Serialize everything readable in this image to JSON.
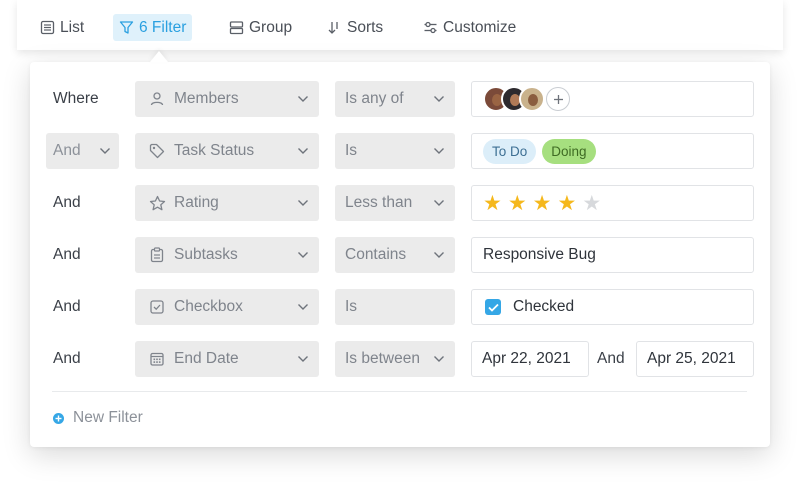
{
  "toolbar": {
    "list_label": "List",
    "filter_label": "6 Filter",
    "group_label": "Group",
    "sorts_label": "Sorts",
    "customize_label": "Customize",
    "active_color": "#2aa0e0"
  },
  "filters": {
    "rows": [
      {
        "conjunction": "Where",
        "field": "Members",
        "field_icon": "person-icon",
        "operator": "Is any of"
      },
      {
        "conjunction": "And",
        "field": "Task Status",
        "field_icon": "tag-icon",
        "operator": "Is",
        "values": [
          "To Do",
          "Doing"
        ]
      },
      {
        "conjunction": "And",
        "field": "Rating",
        "field_icon": "star-outline-icon",
        "operator": "Less than",
        "rating": 4,
        "rating_max": 5
      },
      {
        "conjunction": "And",
        "field": "Subtasks",
        "field_icon": "clipboard-icon",
        "operator": "Contains",
        "value": "Responsive Bug"
      },
      {
        "conjunction": "And",
        "field": "Checkbox",
        "field_icon": "checkbox-icon",
        "operator": "Is",
        "value": "Checked"
      },
      {
        "conjunction": "And",
        "field": "End Date",
        "field_icon": "calendar-icon",
        "operator": "Is between",
        "start": "Apr 22, 2021",
        "joiner": "And",
        "end": "Apr 25, 2021"
      }
    ],
    "new_filter_label": "New Filter"
  },
  "colors": {
    "todo_tag_bg": "#dceef9",
    "doing_tag_bg": "#a6df7f",
    "star_filled": "#f5b81c",
    "star_empty": "#d7d9dc",
    "accent": "#35a7e6"
  }
}
